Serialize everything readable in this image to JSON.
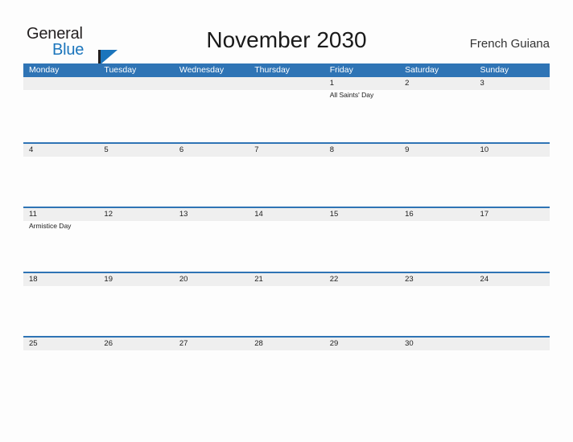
{
  "brand": {
    "name_part1": "General",
    "name_part2": "Blue",
    "flag_icon": "flag-triangle-icon",
    "colors": {
      "dark": "#231f20",
      "blue": "#1b75bc"
    }
  },
  "header": {
    "title": "November 2030",
    "region": "French Guiana"
  },
  "calendar": {
    "accent_color": "#2f74b5",
    "band_color": "#efefef",
    "weekdays": [
      "Monday",
      "Tuesday",
      "Wednesday",
      "Thursday",
      "Friday",
      "Saturday",
      "Sunday"
    ],
    "weeks": [
      {
        "band_width_pct": 100,
        "days": [
          {
            "num": "",
            "event": ""
          },
          {
            "num": "",
            "event": ""
          },
          {
            "num": "",
            "event": ""
          },
          {
            "num": "",
            "event": ""
          },
          {
            "num": "1",
            "event": "All Saints' Day"
          },
          {
            "num": "2",
            "event": ""
          },
          {
            "num": "3",
            "event": ""
          }
        ]
      },
      {
        "band_width_pct": 100,
        "days": [
          {
            "num": "4",
            "event": ""
          },
          {
            "num": "5",
            "event": ""
          },
          {
            "num": "6",
            "event": ""
          },
          {
            "num": "7",
            "event": ""
          },
          {
            "num": "8",
            "event": ""
          },
          {
            "num": "9",
            "event": ""
          },
          {
            "num": "10",
            "event": ""
          }
        ]
      },
      {
        "band_width_pct": 100,
        "days": [
          {
            "num": "11",
            "event": "Armistice Day"
          },
          {
            "num": "12",
            "event": ""
          },
          {
            "num": "13",
            "event": ""
          },
          {
            "num": "14",
            "event": ""
          },
          {
            "num": "15",
            "event": ""
          },
          {
            "num": "16",
            "event": ""
          },
          {
            "num": "17",
            "event": ""
          }
        ]
      },
      {
        "band_width_pct": 100,
        "days": [
          {
            "num": "18",
            "event": ""
          },
          {
            "num": "19",
            "event": ""
          },
          {
            "num": "20",
            "event": ""
          },
          {
            "num": "21",
            "event": ""
          },
          {
            "num": "22",
            "event": ""
          },
          {
            "num": "23",
            "event": ""
          },
          {
            "num": "24",
            "event": ""
          }
        ]
      },
      {
        "band_width_pct": 100,
        "days": [
          {
            "num": "25",
            "event": ""
          },
          {
            "num": "26",
            "event": ""
          },
          {
            "num": "27",
            "event": ""
          },
          {
            "num": "28",
            "event": ""
          },
          {
            "num": "29",
            "event": ""
          },
          {
            "num": "30",
            "event": ""
          },
          {
            "num": "",
            "event": ""
          }
        ]
      }
    ]
  }
}
